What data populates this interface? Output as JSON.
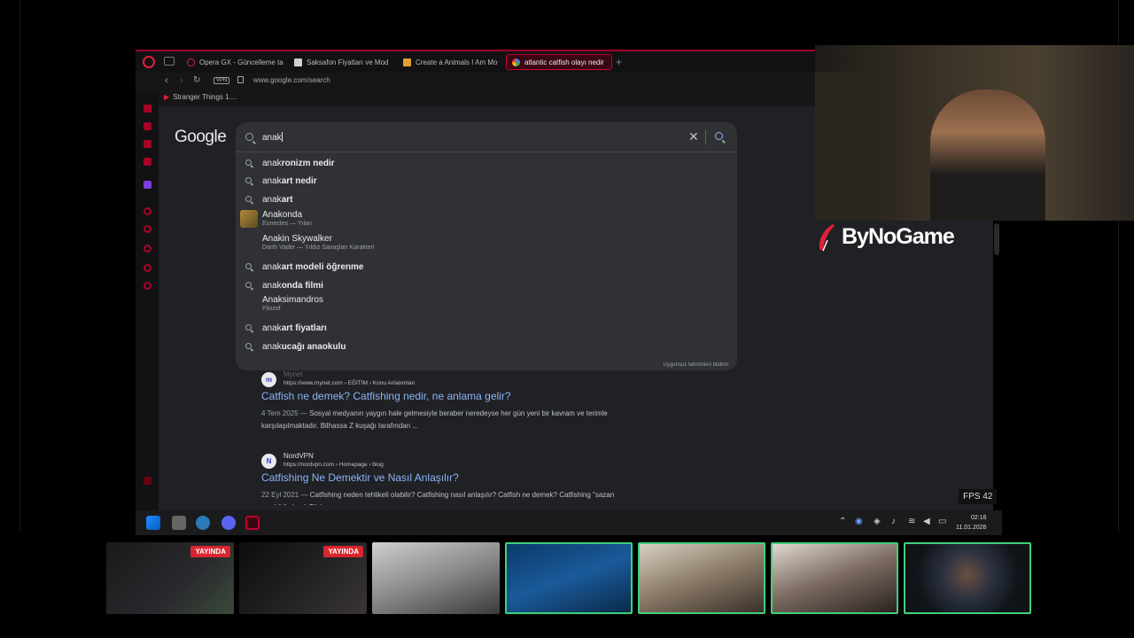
{
  "browser": {
    "tabs": [
      {
        "label": "Opera GX - Güncelleme ta"
      },
      {
        "label": "Saksafon Fiyatları ve Mod"
      },
      {
        "label": "Create a Animals I Am Mo"
      },
      {
        "label": "atlantic catfish olayı nedir"
      }
    ],
    "new_tab": "+",
    "vpn": "VPN",
    "url": "www.google.com/search",
    "bookmark": "Stranger Things 1...."
  },
  "google": {
    "logo": "Google",
    "query": "anak",
    "report_text": "Uygunsuz tahminleri bildirin",
    "suggestions": [
      {
        "prefix": "anak",
        "rest": "ronizm nedir"
      },
      {
        "prefix": "anak",
        "rest": "art nedir"
      },
      {
        "prefix": "anak",
        "rest": "art"
      },
      {
        "entity": true,
        "name": "Anakonda",
        "sub": "Eunectes — Yılan"
      },
      {
        "entity": true,
        "name": "Anakin Skywalker",
        "sub": "Darth Vader — Yıldız Savaşları Karakteri"
      },
      {
        "prefix": "anak",
        "rest": "art modeli öğrenme"
      },
      {
        "prefix": "anak",
        "rest": "onda filmi"
      },
      {
        "entity": true,
        "name": "Anaksimandros",
        "sub": "Filozof"
      },
      {
        "prefix": "anak",
        "rest": "art fiyatları"
      },
      {
        "prefix": "anak",
        "rest": "ucağı anaokulu"
      }
    ],
    "results": [
      {
        "favicon": "m",
        "site": "Mynet",
        "url": "https://www.mynet.com › EĞİTİM › Konu Anlatımları",
        "title": "Catfish ne demek? Catfishing nedir, ne anlama gelir?",
        "date": "4 Tem 2025 —",
        "snippet": "Sosyal medyanın yaygın hale gelmesiyle beraber neredeyse her gün yeni bir kavram ve terimle karşılaşılmaktadır. Bilhassa Z kuşağı tarafından ..."
      },
      {
        "favicon": "N",
        "site": "NordVPN",
        "url": "https://nordvpn.com › Homepage › blog",
        "title": "Catfishing Ne Demektir ve Nasıl Anlaşılır?",
        "date": "22 Eyl 2021 —",
        "snippet": "Catfishing neden tehlikeli olabilir? Catfishing nasıl anlaşılır? Catfish ne demek? Catfishing \"sazan avcılığı\" olarak Türkçeye ..."
      }
    ]
  },
  "overlay": {
    "fps": "FPS 42",
    "brand": "ByNoGame"
  },
  "taskbar": {
    "time": "02:16",
    "date": "11.01.2026"
  },
  "streams": [
    {
      "live": "YAYINDA"
    },
    {
      "live": "YAYINDA"
    },
    {
      "live": ""
    },
    {
      "live": ""
    },
    {
      "live": ""
    },
    {
      "live": ""
    },
    {
      "live": ""
    }
  ]
}
